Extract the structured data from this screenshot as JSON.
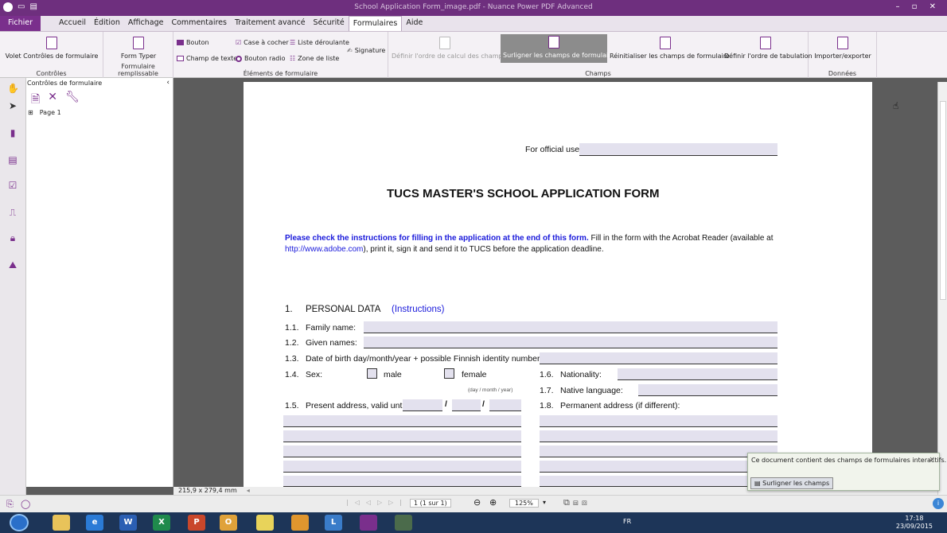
{
  "window": {
    "title": "School Application Form_image.pdf - Nuance Power PDF Advanced",
    "controls": "– ▫ ✕"
  },
  "menu": [
    "Fichier",
    "Accueil",
    "Édition",
    "Affichage",
    "Commentaires",
    "Traitement avancé",
    "Sécurité",
    "Formulaires",
    "Aide"
  ],
  "menu_active": "Formulaires",
  "ribbon": {
    "controles_btn": "Volet Contrôles de formulaire",
    "controles_label": "Contrôles",
    "formtyper_btn": "Form Typer",
    "formtyper_label": "Formulaire remplissable",
    "bouton": "Bouton",
    "champ_texte": "Champ de texte",
    "case_cocher": "Case à cocher",
    "bouton_radio": "Bouton radio",
    "liste_deroulante": "Liste déroulante",
    "zone_liste": "Zone de liste",
    "signature": "Signature",
    "elements_label": "Éléments de formulaire",
    "ordre_calcul": "Définir l'ordre de calcul des champs",
    "surligner": "Surligner les champs de formulaire",
    "reinitialiser": "Réinitialiser les champs de formulaire",
    "tabulation": "Définir l'ordre de tabulation",
    "champs_label": "Champs",
    "importer": "Importer/exporter",
    "donnees_label": "Données"
  },
  "panel": {
    "title": "Contrôles de formulaire",
    "tree_item": "Page 1"
  },
  "page_size": "215,9 x 279,4 mm",
  "document": {
    "official_use": "For official use:",
    "form_title": "TUCS MASTER'S SCHOOL APPLICATION FORM",
    "instr_bold": "Please check the instructions for filling in the application at the end of this form.",
    "instr_rest": " Fill in the form with the Acrobat Reader (available at",
    "instr_url": "http://www.adobe.com",
    "instr_end": "), print it, sign it and send it to TUCS before the application deadline.",
    "section_num": "1.",
    "section_title": "PERSONAL DATA",
    "section_link": "(Instructions)",
    "f11n": "1.1.",
    "f11": "Family name:",
    "f12n": "1.2.",
    "f12": "Given names:",
    "f13n": "1.3.",
    "f13": "Date of birth day/month/year + possible Finnish identity number:",
    "f14n": "1.4.",
    "f14": "Sex:",
    "male": "male",
    "female": "female",
    "dmy_hint": "(day / month / year)",
    "f15n": "1.5.",
    "f15": "Present address, valid until:",
    "slash": "/",
    "f16n": "1.6.",
    "f16": "Nationality:",
    "f17n": "1.7.",
    "f17": "Native language:",
    "f18n": "1.8.",
    "f18": "Permanent address (if different):"
  },
  "status": {
    "page_indicator": "1 (1 sur 1)",
    "zoom": "125%"
  },
  "toast": {
    "message": "Ce document contient des champs de formulaires interactifs.",
    "button": "Surligner les champs",
    "close": "×"
  },
  "taskbar": {
    "lang": "FR",
    "time": "17:18",
    "date": "23/09/2015"
  },
  "colors": {
    "accent": "#7a2f8c",
    "field_fill": "#e3e1ee",
    "link_blue": "#1a1adb"
  }
}
